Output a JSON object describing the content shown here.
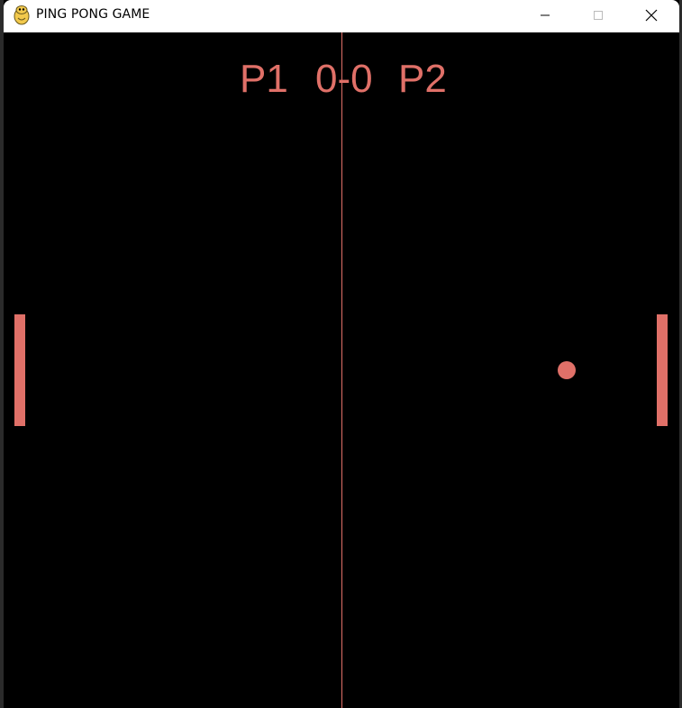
{
  "window": {
    "title": "PING PONG GAME",
    "app_icon": "python-snake-icon",
    "controls": {
      "minimize": "minimize-icon",
      "maximize": "maximize-icon",
      "close": "close-icon"
    }
  },
  "scoreboard": {
    "player1_label": "P1",
    "score": "0-0",
    "player2_label": "P2"
  },
  "colors": {
    "background": "#000000",
    "accent": "#e07068",
    "titlebar": "#ffffff"
  }
}
